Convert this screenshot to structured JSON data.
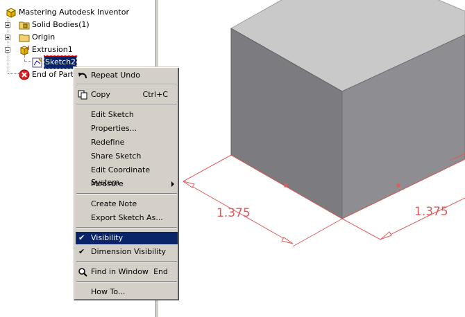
{
  "browser": {
    "root_label": "Mastering Autodesk Inventor",
    "items": [
      {
        "label": "Solid Bodies(1)",
        "icon": "solid-bodies-folder-icon"
      },
      {
        "label": "Origin",
        "icon": "folder-icon"
      },
      {
        "label": "Extrusion1",
        "icon": "extrusion-icon"
      },
      {
        "label": "Sketch2",
        "icon": "sketch-icon"
      },
      {
        "label": "End of Part",
        "icon": "end-of-part-icon"
      }
    ]
  },
  "context_menu": {
    "repeat_undo": "Repeat Undo",
    "copy": "Copy",
    "copy_shortcut": "Ctrl+C",
    "edit_sketch": "Edit Sketch",
    "properties": "Properties...",
    "redefine": "Redefine",
    "share_sketch": "Share Sketch",
    "edit_coordinate_system": "Edit Coordinate System",
    "measure": "Measure",
    "create_note": "Create Note",
    "export_sketch_as": "Export Sketch As...",
    "visibility": "Visibility",
    "dimension_visibility": "Dimension Visibility",
    "find_in_window": "Find in Window",
    "find_in_window_shortcut": "End",
    "how_to": "How To...",
    "check_mark": "✔"
  },
  "viewport": {
    "dimension_left": "1.375",
    "dimension_right": "1.375"
  },
  "colors": {
    "menu_bg": "#d4d0c8",
    "highlight": "#0a246a",
    "dimension_red": "#e05a5a",
    "cube_top": "#c9c9c9",
    "cube_left": "#7c7c80",
    "cube_right": "#8d8d92"
  }
}
